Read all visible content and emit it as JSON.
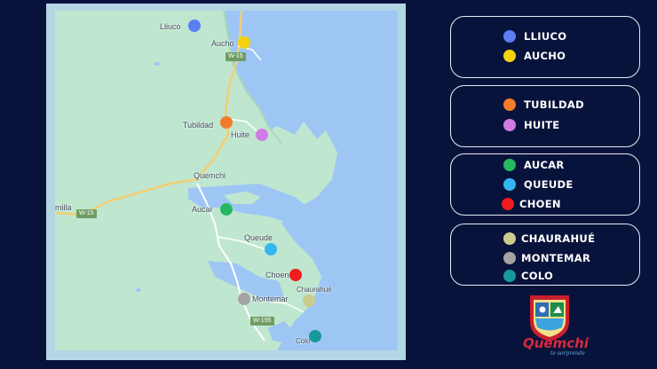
{
  "map": {
    "places": [
      {
        "id": "lliuco",
        "label": "Lliuco"
      },
      {
        "id": "aucho",
        "label": "Aucho"
      },
      {
        "id": "tubildad",
        "label": "Tubildad"
      },
      {
        "id": "huite",
        "label": "Huite"
      },
      {
        "id": "quemchi",
        "label": "Quemchi"
      },
      {
        "id": "aucar",
        "label": "Aucar"
      },
      {
        "id": "queude",
        "label": "Queude"
      },
      {
        "id": "choen",
        "label": "Choen"
      },
      {
        "id": "chaurahue",
        "label": "Chaurahué"
      },
      {
        "id": "montemar",
        "label": "Montemar"
      },
      {
        "id": "colo",
        "label": "Colo"
      },
      {
        "id": "amilla",
        "label": "milla"
      }
    ],
    "roads": [
      "W-15",
      "W-15",
      "W-195"
    ],
    "colors": {
      "water": "#9ec6f5",
      "land": "#bfe7cf",
      "road": "#ffffff",
      "road_primary": "#f2cf73"
    }
  },
  "legend": {
    "groups": [
      {
        "items": [
          {
            "label": "LLIUCO",
            "color": "#5b7ef5"
          },
          {
            "label": "AUCHO",
            "color": "#f5d20d"
          }
        ]
      },
      {
        "items": [
          {
            "label": "TUBILDAD",
            "color": "#f27b2b"
          },
          {
            "label": "HUITE",
            "color": "#d07be6"
          }
        ]
      },
      {
        "items": [
          {
            "label": "AUCAR",
            "color": "#27b763"
          },
          {
            "label": "QUEUDE",
            "color": "#35b6f2"
          },
          {
            "label": "CHOEN",
            "color": "#ef1d1d"
          }
        ]
      },
      {
        "items": [
          {
            "label": "CHAURAHUÉ",
            "color": "#cccb8e"
          },
          {
            "label": "MONTEMAR",
            "color": "#a3a3a3"
          },
          {
            "label": "COLO",
            "color": "#159a99"
          }
        ]
      }
    ]
  },
  "logo": {
    "name": "Quemchi",
    "ribbon": "QUEMCHI",
    "tagline": "te sorprende"
  }
}
